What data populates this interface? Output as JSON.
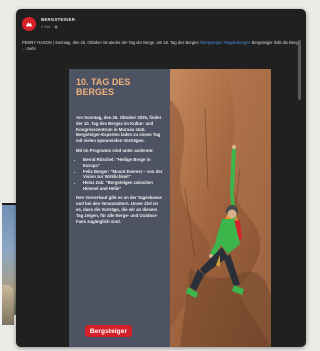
{
  "post": {
    "page_name": "BERGSTEIGER",
    "meta": "2 Std. · ◉",
    "text_lead": "PENNY HASON | Sonntag, den 26. Oktober ist wieder der Tag der Berge, am 18. Tag des Berges",
    "text_link": "#bergsteiger #tagdesberges",
    "text_tail": "Bergsteiger liebt die Berge ... mehr"
  },
  "graphic": {
    "title_lines": [
      "10. TAG DES",
      "BERGES"
    ],
    "intro": "Am Sonntag, den 26. Oktober 2025, findet der 10. Tag des Berges im Kultur- und Kongresszentrum in Murnau statt. Bergsteiger-Experten laden zu einem Tag mit vielen spannenden Vorträgen.",
    "program_heading": "Mit im Programm sind unter anderem:",
    "program_items": [
      "Bernd Ritschel: \"Heilige Berge in Europa\"",
      "Felix Berger: \"Mount Everest – von der Vision zur Wirklichkeit\"",
      "Heinz Zak: \"Bergsteigen zwischen Himmel und Hölle\""
    ],
    "closing": "Den Vorverkauf gibt es an der Tageskasse und bei den Veranstaltern. Unser Ziel ist es, dass die Vorträge, die wir an diesem Tag zeigen, für alle Berge- und Outdoor-Fans zugänglich sind.",
    "brand_logo_text": "Bergsteiger"
  },
  "colors": {
    "brand_red": "#d6212b",
    "title_orange": "#f0b17a",
    "panel": "#4e5364",
    "card": "#202020",
    "link": "#4a8bd8"
  },
  "icons": [
    "page-avatar-icon",
    "globe-icon"
  ]
}
